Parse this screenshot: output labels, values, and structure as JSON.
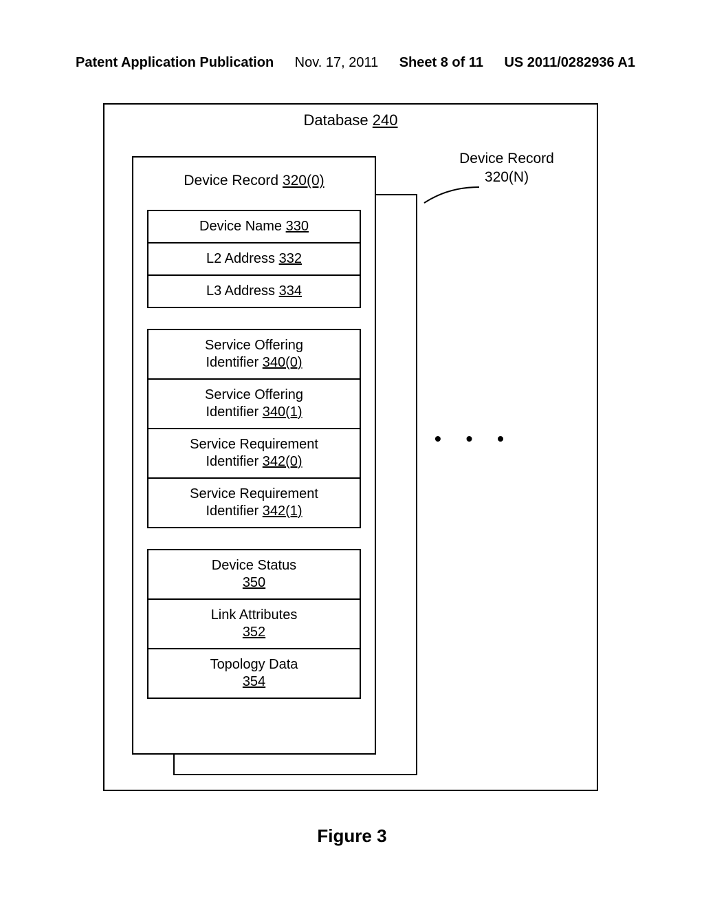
{
  "header": {
    "pub_type": "Patent Application Publication",
    "date": "Nov. 17, 2011",
    "sheet": "Sheet 8 of 11",
    "pubnum": "US 2011/0282936 A1"
  },
  "database": {
    "title_text": "Database",
    "title_ref": "240"
  },
  "record0": {
    "title_text": "Device Record",
    "title_ref": "320(0)",
    "group1": [
      {
        "label": "Device Name",
        "ref": "330"
      },
      {
        "label": "L2 Address",
        "ref": "332"
      },
      {
        "label": "L3 Address",
        "ref": "334"
      }
    ],
    "group2": [
      {
        "label": "Service Offering Identifier",
        "ref": "340(0)"
      },
      {
        "label": "Service Offering Identifier",
        "ref": "340(1)"
      },
      {
        "label": "Service Requirement Identifier",
        "ref": "342(0)"
      },
      {
        "label": "Service Requirement Identifier",
        "ref": "342(1)"
      }
    ],
    "group3": [
      {
        "label": "Device Status",
        "ref": "350"
      },
      {
        "label": "Link Attributes",
        "ref": "352"
      },
      {
        "label": "Topology Data",
        "ref": "354"
      }
    ]
  },
  "recordN": {
    "label_text": "Device Record",
    "label_ref": "320(N)"
  },
  "ellipsis": "•  •  •",
  "figure_caption": "Figure 3"
}
